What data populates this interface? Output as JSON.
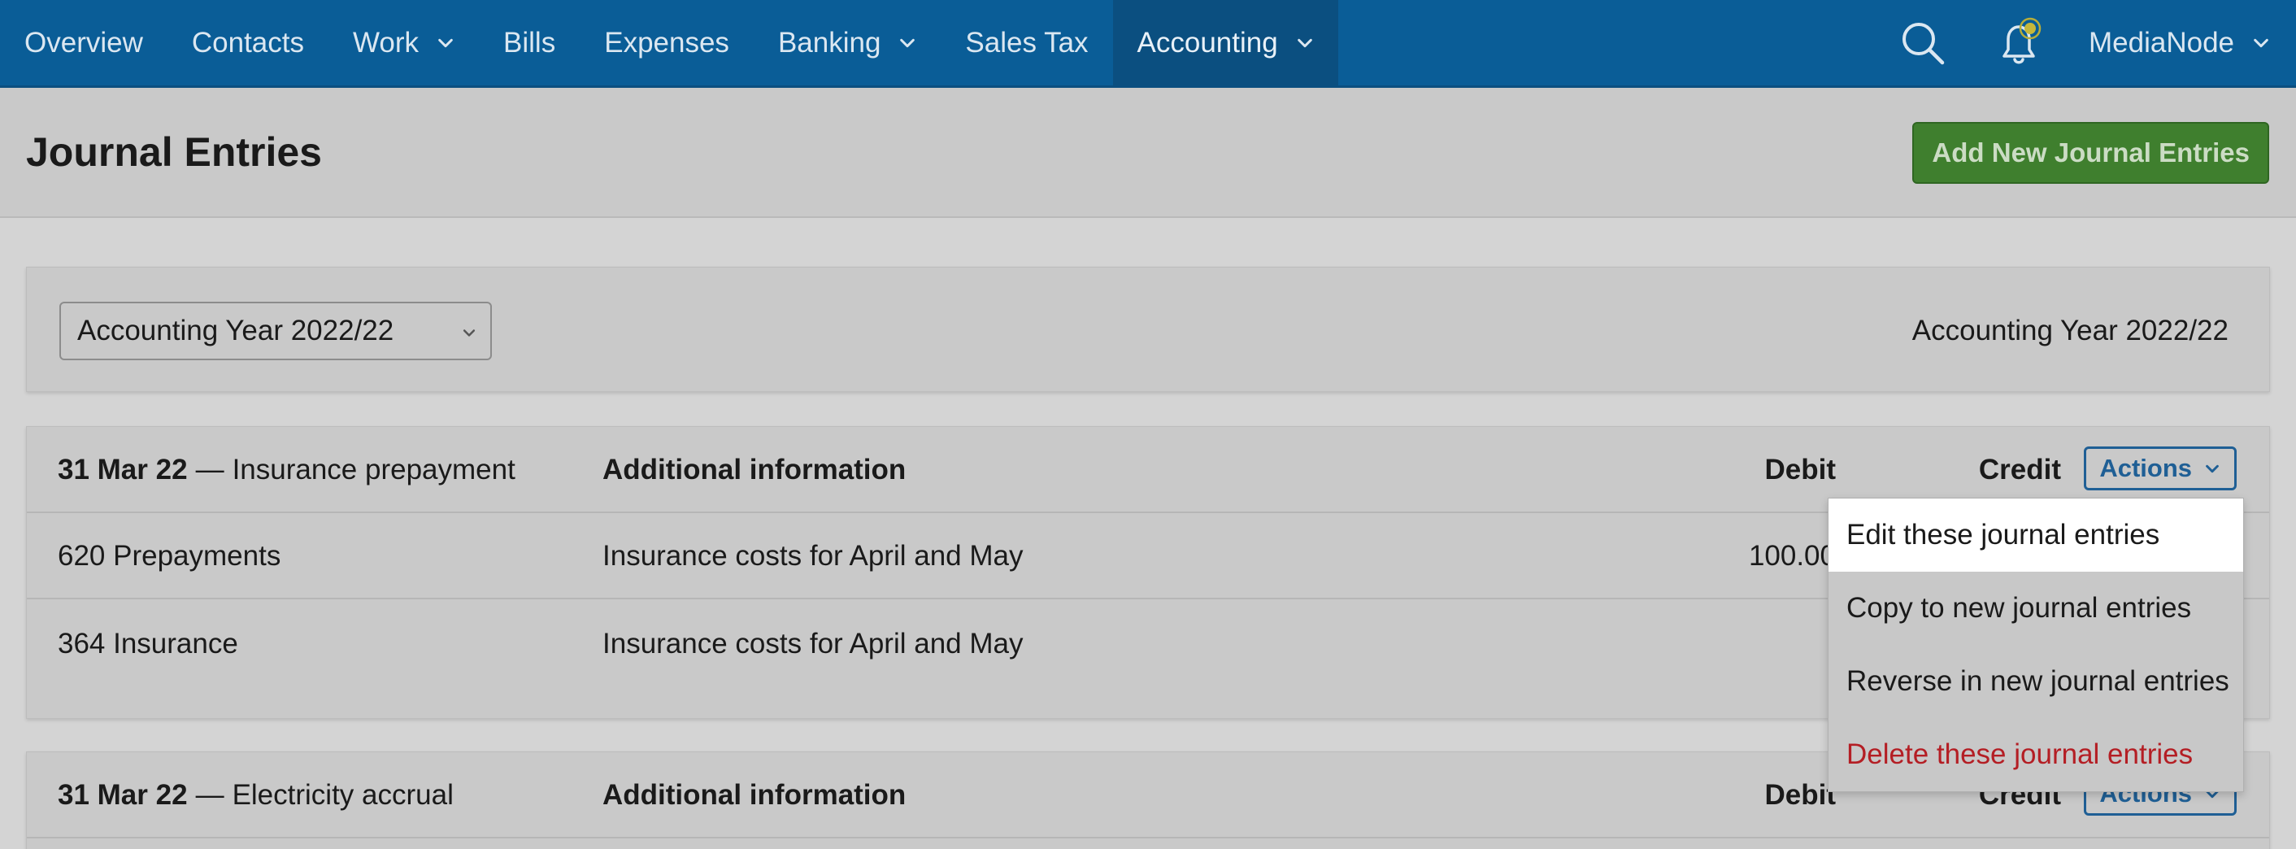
{
  "nav": {
    "items": [
      {
        "label": "Overview",
        "dropdown": false
      },
      {
        "label": "Contacts",
        "dropdown": false
      },
      {
        "label": "Work",
        "dropdown": true
      },
      {
        "label": "Bills",
        "dropdown": false
      },
      {
        "label": "Expenses",
        "dropdown": false
      },
      {
        "label": "Banking",
        "dropdown": true
      },
      {
        "label": "Sales Tax",
        "dropdown": false
      },
      {
        "label": "Accounting",
        "dropdown": true,
        "active": true
      }
    ],
    "search_icon": "search-icon",
    "notification_icon": "bell-icon",
    "user": "MediaNode"
  },
  "header": {
    "title": "Journal Entries",
    "add_button": "Add New Journal Entries"
  },
  "filter": {
    "selected_year": "Accounting Year 2022/22",
    "year_label": "Accounting Year 2022/22"
  },
  "entries": [
    {
      "date": "31 Mar 22",
      "separator": "—",
      "description": "Insurance prepayment",
      "col_info": "Additional information",
      "col_debit": "Debit",
      "col_credit": "Credit",
      "actions": "Actions",
      "rows": [
        {
          "account": "620 Prepayments",
          "info": "Insurance costs for April and May",
          "debit": "100.00"
        },
        {
          "account": "364 Insurance",
          "info": "Insurance costs for April and May",
          "debit": ""
        }
      ]
    },
    {
      "date": "31 Mar 22",
      "separator": "—",
      "description": "Electricity accrual",
      "col_info": "Additional information",
      "col_debit": "Debit",
      "col_credit": "Credit",
      "actions": "Actions"
    }
  ],
  "actions_menu": {
    "items": [
      {
        "label": "Edit these journal entries"
      },
      {
        "label": "Copy to new journal entries"
      },
      {
        "label": "Reverse in new journal entries"
      },
      {
        "label": "Delete these journal entries"
      }
    ]
  },
  "colors": {
    "nav_bg": "#0a5d97",
    "primary_green": "#3f7f2e",
    "link_blue": "#1f5f95",
    "danger_red": "#b41e24"
  }
}
